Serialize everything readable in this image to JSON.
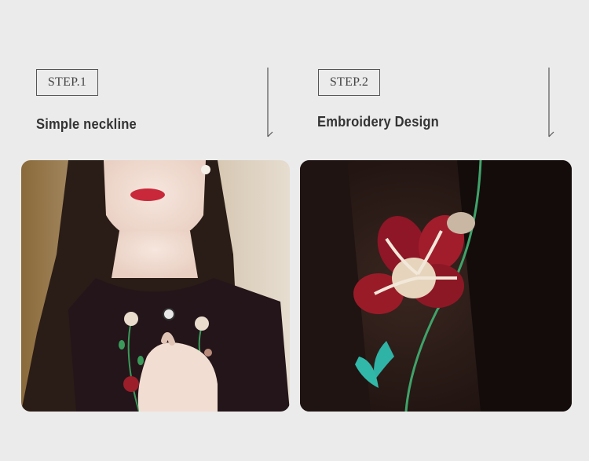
{
  "steps": [
    {
      "label": "STEP.1",
      "title": "Simple neckline"
    },
    {
      "label": "STEP.2",
      "title": "Embroidery Design"
    }
  ],
  "colors": {
    "background": "#ebebeb",
    "fabric": "#2a1a18",
    "embroidery_red": "#9c1e2a",
    "embroidery_green": "#3a9a5a"
  }
}
